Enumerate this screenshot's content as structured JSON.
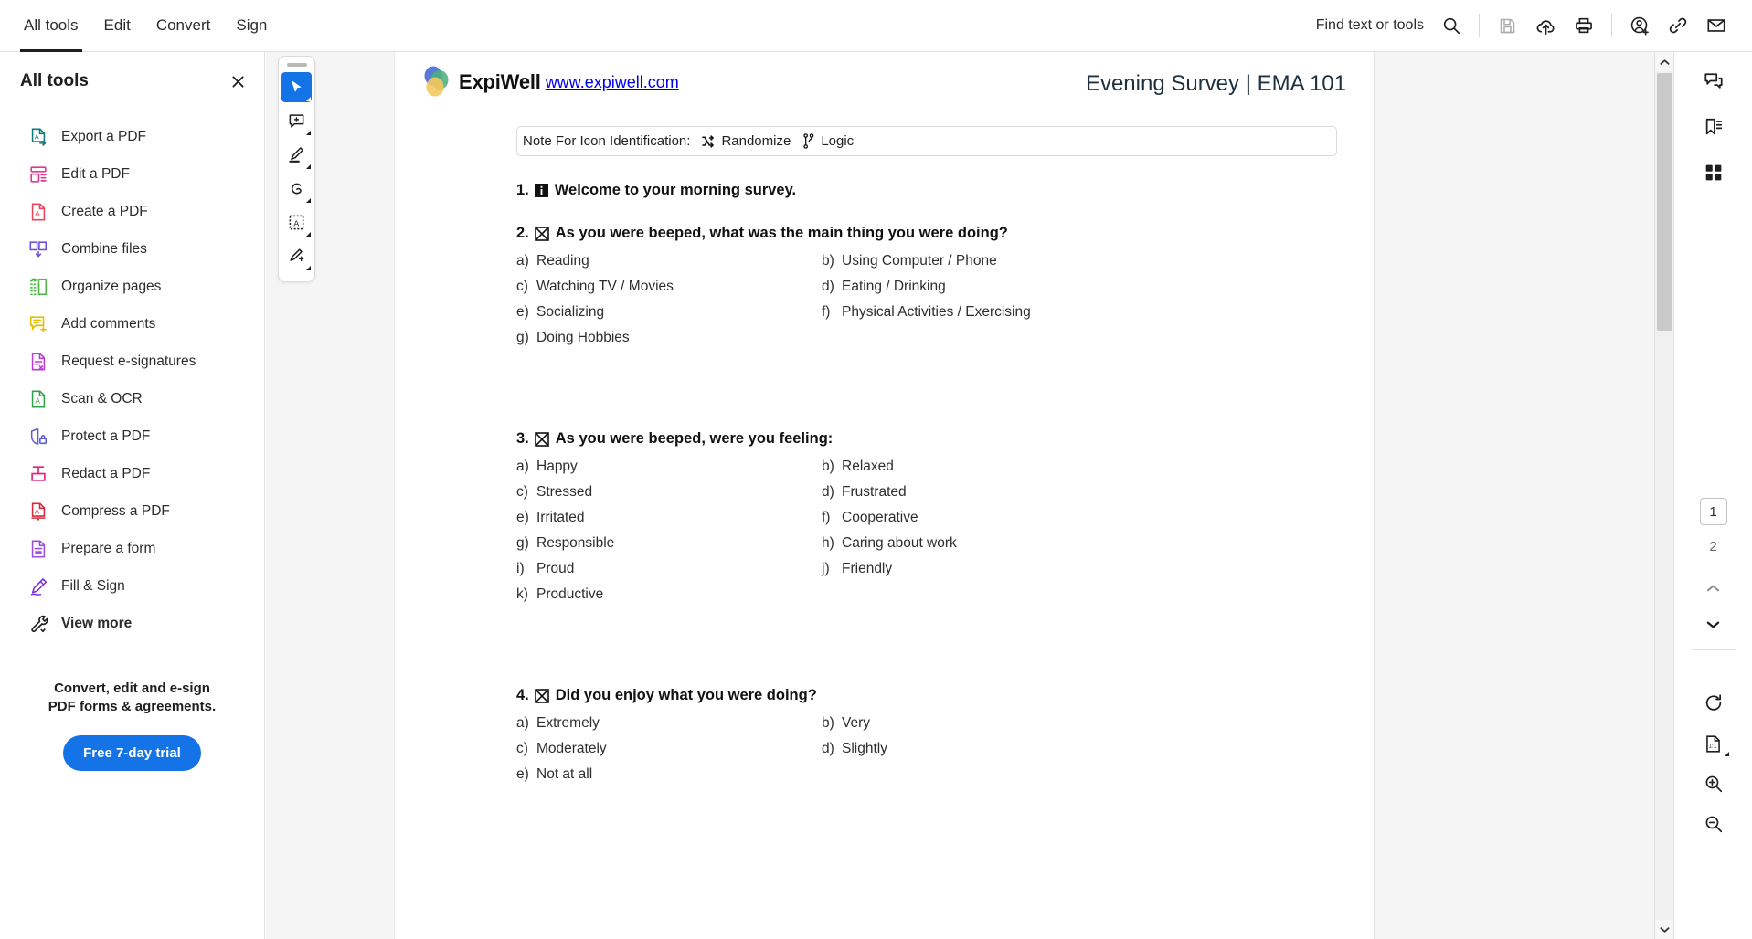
{
  "topbar": {
    "menu": [
      {
        "label": "All tools",
        "active": true
      },
      {
        "label": "Edit",
        "active": false
      },
      {
        "label": "Convert",
        "active": false
      },
      {
        "label": "Sign",
        "active": false
      }
    ],
    "find_label": "Find text or tools",
    "icons": [
      {
        "name": "search-icon"
      },
      {
        "name": "save-icon"
      },
      {
        "name": "upload-cloud-icon"
      },
      {
        "name": "print-icon"
      },
      {
        "name": "add-person-icon"
      },
      {
        "name": "link-icon"
      },
      {
        "name": "mail-icon"
      }
    ]
  },
  "left_panel": {
    "title": "All tools",
    "close_icon": "close-icon",
    "tools": [
      {
        "label": "Export a PDF",
        "icon": "export-pdf-icon",
        "color": "#0f7b7b"
      },
      {
        "label": "Edit a PDF",
        "icon": "edit-pdf-icon",
        "color": "#e8368f"
      },
      {
        "label": "Create a PDF",
        "icon": "create-pdf-icon",
        "color": "#e8465a"
      },
      {
        "label": "Combine files",
        "icon": "combine-files-icon",
        "color": "#6d4fdb"
      },
      {
        "label": "Organize pages",
        "icon": "organize-pages-icon",
        "color": "#4cb944"
      },
      {
        "label": "Add comments",
        "icon": "add-comments-icon",
        "color": "#e2c000"
      },
      {
        "label": "Request e-signatures",
        "icon": "request-esignatures-icon",
        "color": "#b93fd6"
      },
      {
        "label": "Scan & OCR",
        "icon": "scan-ocr-icon",
        "color": "#31a34a"
      },
      {
        "label": "Protect a PDF",
        "icon": "protect-pdf-icon",
        "color": "#5b5bd6"
      },
      {
        "label": "Redact a PDF",
        "icon": "redact-pdf-icon",
        "color": "#e0247e"
      },
      {
        "label": "Compress a PDF",
        "icon": "compress-pdf-icon",
        "color": "#d42b3a"
      },
      {
        "label": "Prepare a form",
        "icon": "prepare-form-icon",
        "color": "#9b4fe0"
      },
      {
        "label": "Fill & Sign",
        "icon": "fill-sign-icon",
        "color": "#7b2fd6"
      },
      {
        "label": "View more",
        "icon": "view-more-icon",
        "color": "#1f1f1f"
      }
    ],
    "promo": {
      "text": "Convert, edit and e-sign PDF forms & agreements.",
      "button": "Free 7-day trial",
      "button_color": "#1473e6"
    }
  },
  "vertical_toolbar": {
    "tools": [
      {
        "name": "select-tool",
        "selected": true
      },
      {
        "name": "add-comment-tool",
        "selected": false
      },
      {
        "name": "highlight-tool",
        "selected": false
      },
      {
        "name": "draw-tool",
        "selected": false
      },
      {
        "name": "add-text-tool",
        "selected": false
      },
      {
        "name": "sign-tool",
        "selected": false
      }
    ]
  },
  "document": {
    "brand": {
      "name": "ExpiWell",
      "url": "www.expiwell.com",
      "logo_colors": [
        "#4a6fd4",
        "#4caf7d",
        "#f4c75e"
      ]
    },
    "title": "Evening Survey | EMA 101",
    "note": {
      "label": "Note For Icon Identification:",
      "items": [
        {
          "icon": "randomize-icon",
          "label": "Randomize"
        },
        {
          "icon": "logic-icon",
          "label": "Logic"
        }
      ]
    },
    "questions": [
      {
        "number": "1.",
        "icon": "info-box-icon",
        "text": "Welcome to your morning survey.",
        "options": []
      },
      {
        "number": "2.",
        "icon": "checkbox-x-icon",
        "text": "As you were beeped, what was the main thing you were doing?",
        "options": [
          {
            "letter": "a)",
            "label": "Reading"
          },
          {
            "letter": "b)",
            "label": "Using Computer / Phone"
          },
          {
            "letter": "c)",
            "label": "Watching TV / Movies"
          },
          {
            "letter": "d)",
            "label": "Eating / Drinking"
          },
          {
            "letter": "e)",
            "label": "Socializing"
          },
          {
            "letter": "f)",
            "label": "Physical Activities / Exercising"
          },
          {
            "letter": "g)",
            "label": "Doing Hobbies"
          }
        ]
      },
      {
        "number": "3.",
        "icon": "checkbox-x-icon",
        "text": "As you were beeped, were you feeling:",
        "options": [
          {
            "letter": "a)",
            "label": "Happy"
          },
          {
            "letter": "b)",
            "label": "Relaxed"
          },
          {
            "letter": "c)",
            "label": "Stressed"
          },
          {
            "letter": "d)",
            "label": "Frustrated"
          },
          {
            "letter": "e)",
            "label": "Irritated"
          },
          {
            "letter": "f)",
            "label": "Cooperative"
          },
          {
            "letter": "g)",
            "label": "Responsible"
          },
          {
            "letter": "h)",
            "label": "Caring about work"
          },
          {
            "letter": "i)",
            "label": "Proud"
          },
          {
            "letter": "j)",
            "label": "Friendly"
          },
          {
            "letter": "k)",
            "label": "Productive"
          }
        ]
      },
      {
        "number": "4.",
        "icon": "checkbox-x-icon",
        "text": "Did you enjoy what you were doing?",
        "options": [
          {
            "letter": "a)",
            "label": "Extremely"
          },
          {
            "letter": "b)",
            "label": "Very"
          },
          {
            "letter": "c)",
            "label": "Moderately"
          },
          {
            "letter": "d)",
            "label": "Slightly"
          },
          {
            "letter": "e)",
            "label": "Not at all"
          }
        ]
      }
    ]
  },
  "right_bar": {
    "top_icons": [
      {
        "name": "comments-panel-icon"
      },
      {
        "name": "bookmarks-panel-icon"
      },
      {
        "name": "page-thumbnails-icon"
      }
    ],
    "pages": {
      "current": "1",
      "next": "2"
    },
    "nav": {
      "prev_icon": "chevron-up-icon",
      "next_icon": "chevron-down-icon"
    },
    "bottom_icons": [
      {
        "name": "rotate-icon"
      },
      {
        "name": "fit-page-icon"
      },
      {
        "name": "zoom-in-icon"
      },
      {
        "name": "zoom-out-icon"
      }
    ]
  },
  "scrollbar": {
    "up_icon": "chevron-up-icon",
    "down_icon": "chevron-down-icon"
  }
}
